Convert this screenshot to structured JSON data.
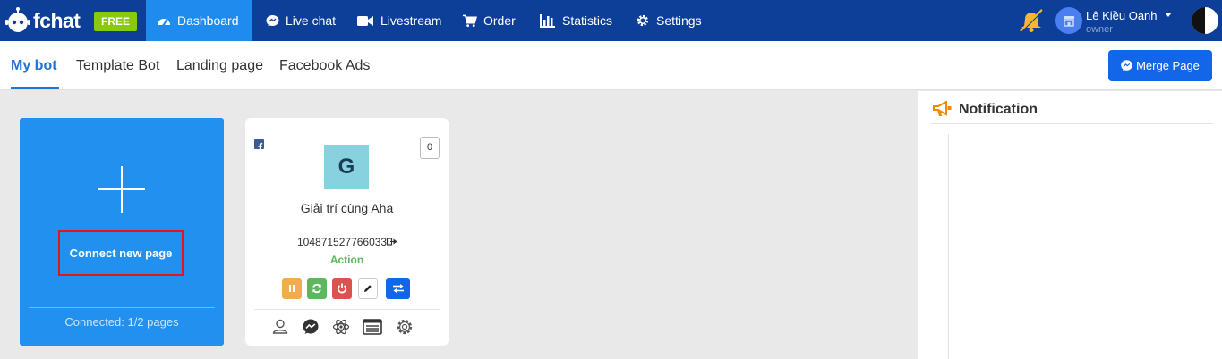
{
  "brand": {
    "name": "fchat",
    "plan_badge": "FREE"
  },
  "nav": {
    "items": [
      {
        "label": "Dashboard",
        "icon": "dashboard-icon",
        "active": true
      },
      {
        "label": "Live chat",
        "icon": "chat-bubble-icon"
      },
      {
        "label": "Livestream",
        "icon": "video-camera-icon"
      },
      {
        "label": "Order",
        "icon": "cart-icon"
      },
      {
        "label": "Statistics",
        "icon": "bar-chart-icon"
      },
      {
        "label": "Settings",
        "icon": "gear-icon"
      }
    ]
  },
  "user": {
    "name": "Lê Kiều Oanh",
    "role": "owner"
  },
  "tabs": [
    {
      "label": "My bot",
      "active": true
    },
    {
      "label": "Template Bot"
    },
    {
      "label": "Landing page"
    },
    {
      "label": "Facebook Ads"
    }
  ],
  "merge_button": {
    "label": "Merge Page",
    "icon": "messenger-icon"
  },
  "connect_card": {
    "button_label": "Connect new page",
    "connected_text": "Connected: 1/2 pages"
  },
  "page_card": {
    "platform_icon": "facebook-icon",
    "count": "0",
    "avatar_letter": "G",
    "name": "Giải trí cùng Aha",
    "page_id": "104871527766033",
    "status": "Action",
    "actions": [
      {
        "name": "pause-button",
        "icon": "pause-icon",
        "color": "#f0ad4e"
      },
      {
        "name": "sync-button",
        "icon": "refresh-icon",
        "color": "#5cb85c"
      },
      {
        "name": "power-button",
        "icon": "power-icon",
        "color": "#d9534f"
      },
      {
        "name": "edit-button",
        "icon": "pencil-icon",
        "color": "#ffffff"
      },
      {
        "name": "transfer-button",
        "icon": "swap-icon",
        "color": "#1366e8"
      }
    ],
    "bottom_icons": [
      "user-icon",
      "messenger-icon",
      "atom-icon",
      "list-icon",
      "gear-icon"
    ]
  },
  "notification": {
    "title": "Notification"
  },
  "colors": {
    "nav_bg": "#0d3f99",
    "nav_active": "#1f8bef",
    "primary": "#1366e8",
    "connect_card": "#2190ee",
    "highlight": "#e0161c",
    "status_green": "#5cb85c",
    "plan_badge": "#8bc90e"
  }
}
